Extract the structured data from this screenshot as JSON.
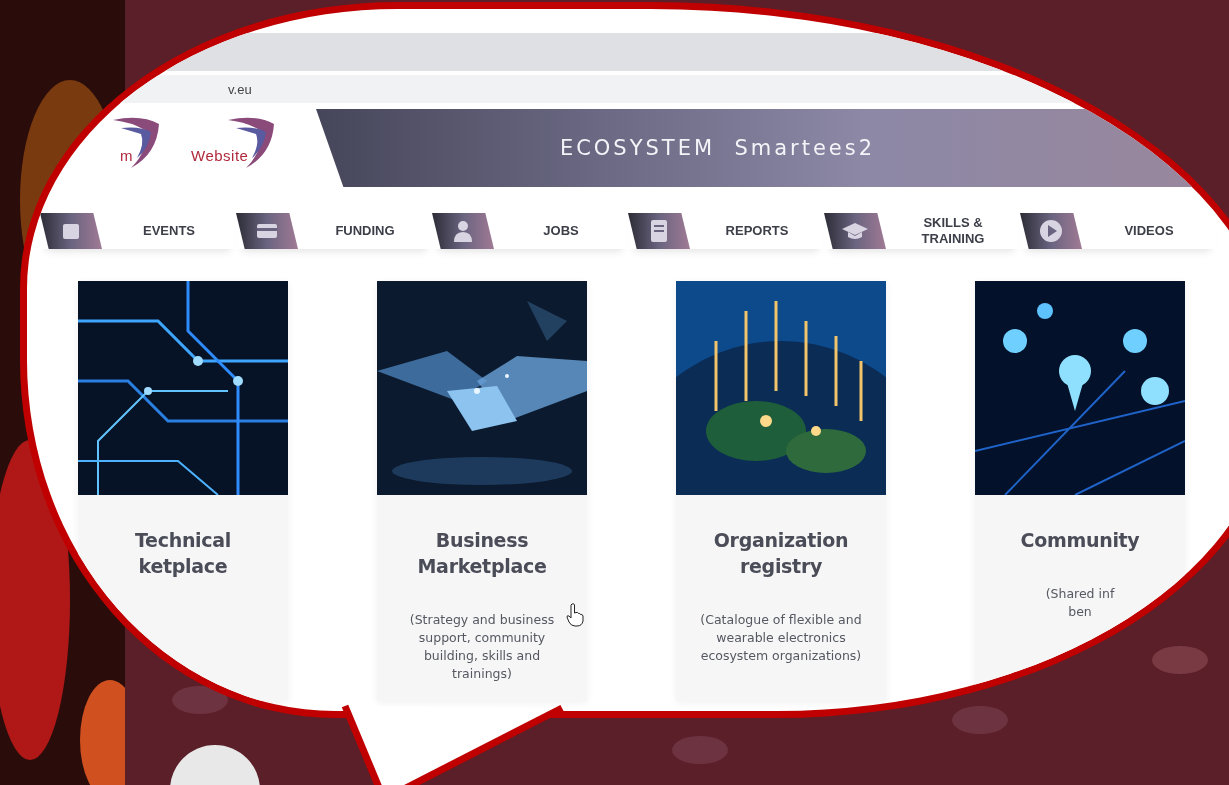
{
  "browser": {
    "url": "v.eu"
  },
  "header": {
    "logos": [
      {
        "text": "m"
      },
      {
        "text": "Website"
      }
    ],
    "title": "ECOSYSTEM  Smartees2"
  },
  "nav": [
    {
      "label": "EVENTS"
    },
    {
      "label": "FUNDING"
    },
    {
      "label": "JOBS"
    },
    {
      "label": "REPORTS"
    },
    {
      "label": "SKILLS &\nTRAINING"
    },
    {
      "label": "VIDEOS"
    }
  ],
  "cards": [
    {
      "title": "Technical\nketplace"
    },
    {
      "title": "Business\nMarketplace",
      "description": "(Strategy and business\nsupport, community\nbuilding, skills and\ntrainings)"
    },
    {
      "title": "Organization\nregistry",
      "description": "(Catalogue of flexible and\nwearable electronics\necosystem organizations)"
    },
    {
      "title": "Community",
      "description": "(Shared inf\nben"
    }
  ]
}
